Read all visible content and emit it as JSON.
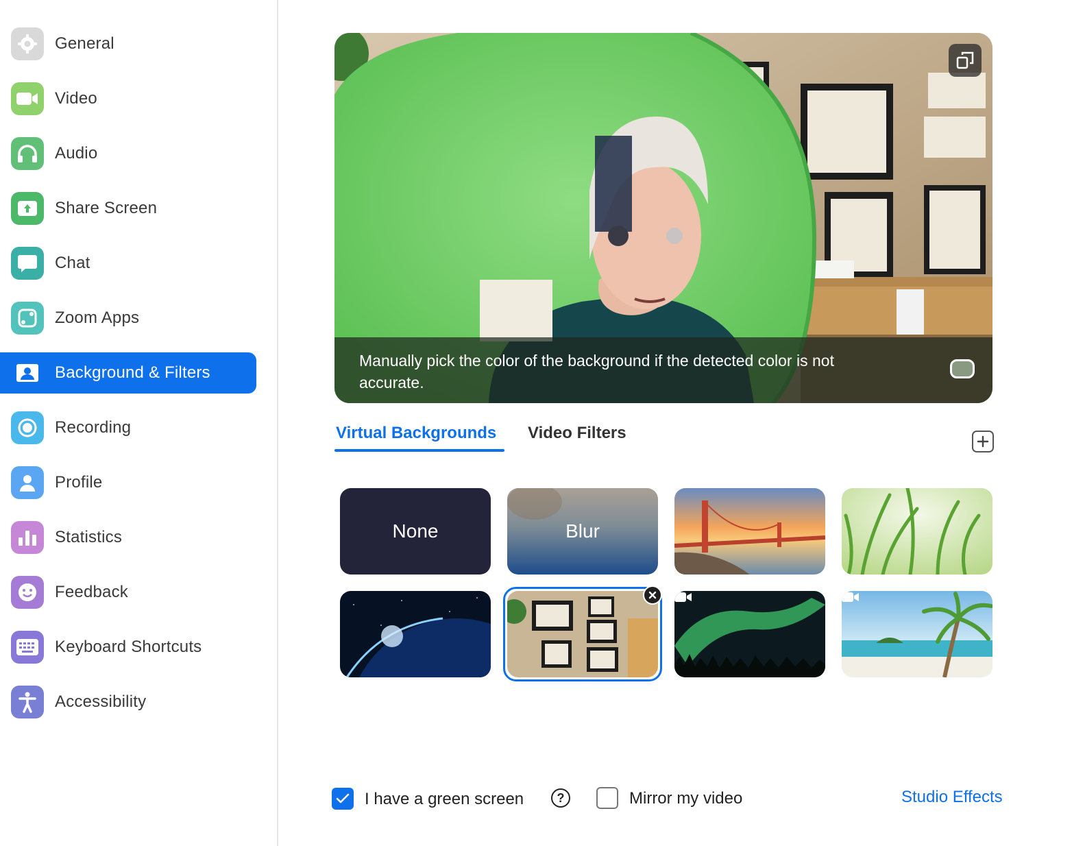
{
  "sidebar": {
    "items": [
      {
        "label": "General",
        "icon": "gear-icon",
        "color": "#d8d8d8"
      },
      {
        "label": "Video",
        "icon": "video-camera-icon",
        "color": "#8fd16a"
      },
      {
        "label": "Audio",
        "icon": "headphones-icon",
        "color": "#62bf77"
      },
      {
        "label": "Share Screen",
        "icon": "share-screen-icon",
        "color": "#4cb86a"
      },
      {
        "label": "Chat",
        "icon": "chat-bubble-icon",
        "color": "#3aafa5"
      },
      {
        "label": "Zoom Apps",
        "icon": "apps-icon",
        "color": "#52c2bc"
      },
      {
        "label": "Background & Filters",
        "icon": "person-card-icon",
        "color": "#0e71eb"
      },
      {
        "label": "Recording",
        "icon": "record-icon",
        "color": "#4bb8ec"
      },
      {
        "label": "Profile",
        "icon": "profile-icon",
        "color": "#5aa6f2"
      },
      {
        "label": "Statistics",
        "icon": "bar-chart-icon",
        "color": "#c688d6"
      },
      {
        "label": "Feedback",
        "icon": "smiley-icon",
        "color": "#a47cd6"
      },
      {
        "label": "Keyboard Shortcuts",
        "icon": "keyboard-icon",
        "color": "#8a78d8"
      },
      {
        "label": "Accessibility",
        "icon": "accessibility-icon",
        "color": "#7a7fd6"
      }
    ],
    "active_index": 6
  },
  "preview": {
    "hint": "Manually pick the color of the background if the detected color is not accurate.",
    "pip_icon": "pop-out-icon",
    "color_picker_icon": "color-swatch-icon"
  },
  "tabs": [
    {
      "label": "Virtual Backgrounds",
      "active": true
    },
    {
      "label": "Video Filters",
      "active": false
    }
  ],
  "add_icon": "plus-icon",
  "backgrounds": [
    {
      "label": "None",
      "kind": "none"
    },
    {
      "label": "Blur",
      "kind": "blur"
    },
    {
      "label": "",
      "kind": "golden-gate-bridge"
    },
    {
      "label": "",
      "kind": "grass"
    },
    {
      "label": "",
      "kind": "earth-from-space"
    },
    {
      "label": "",
      "kind": "office-diplomas",
      "selected": true
    },
    {
      "label": "",
      "kind": "aurora",
      "video": true
    },
    {
      "label": "",
      "kind": "beach",
      "video": true
    }
  ],
  "green_screen": {
    "label": "I have a green screen",
    "checked": true
  },
  "mirror": {
    "label": "Mirror my video",
    "checked": false
  },
  "studio_effects": "Studio Effects",
  "accent_color": "#0e71eb"
}
